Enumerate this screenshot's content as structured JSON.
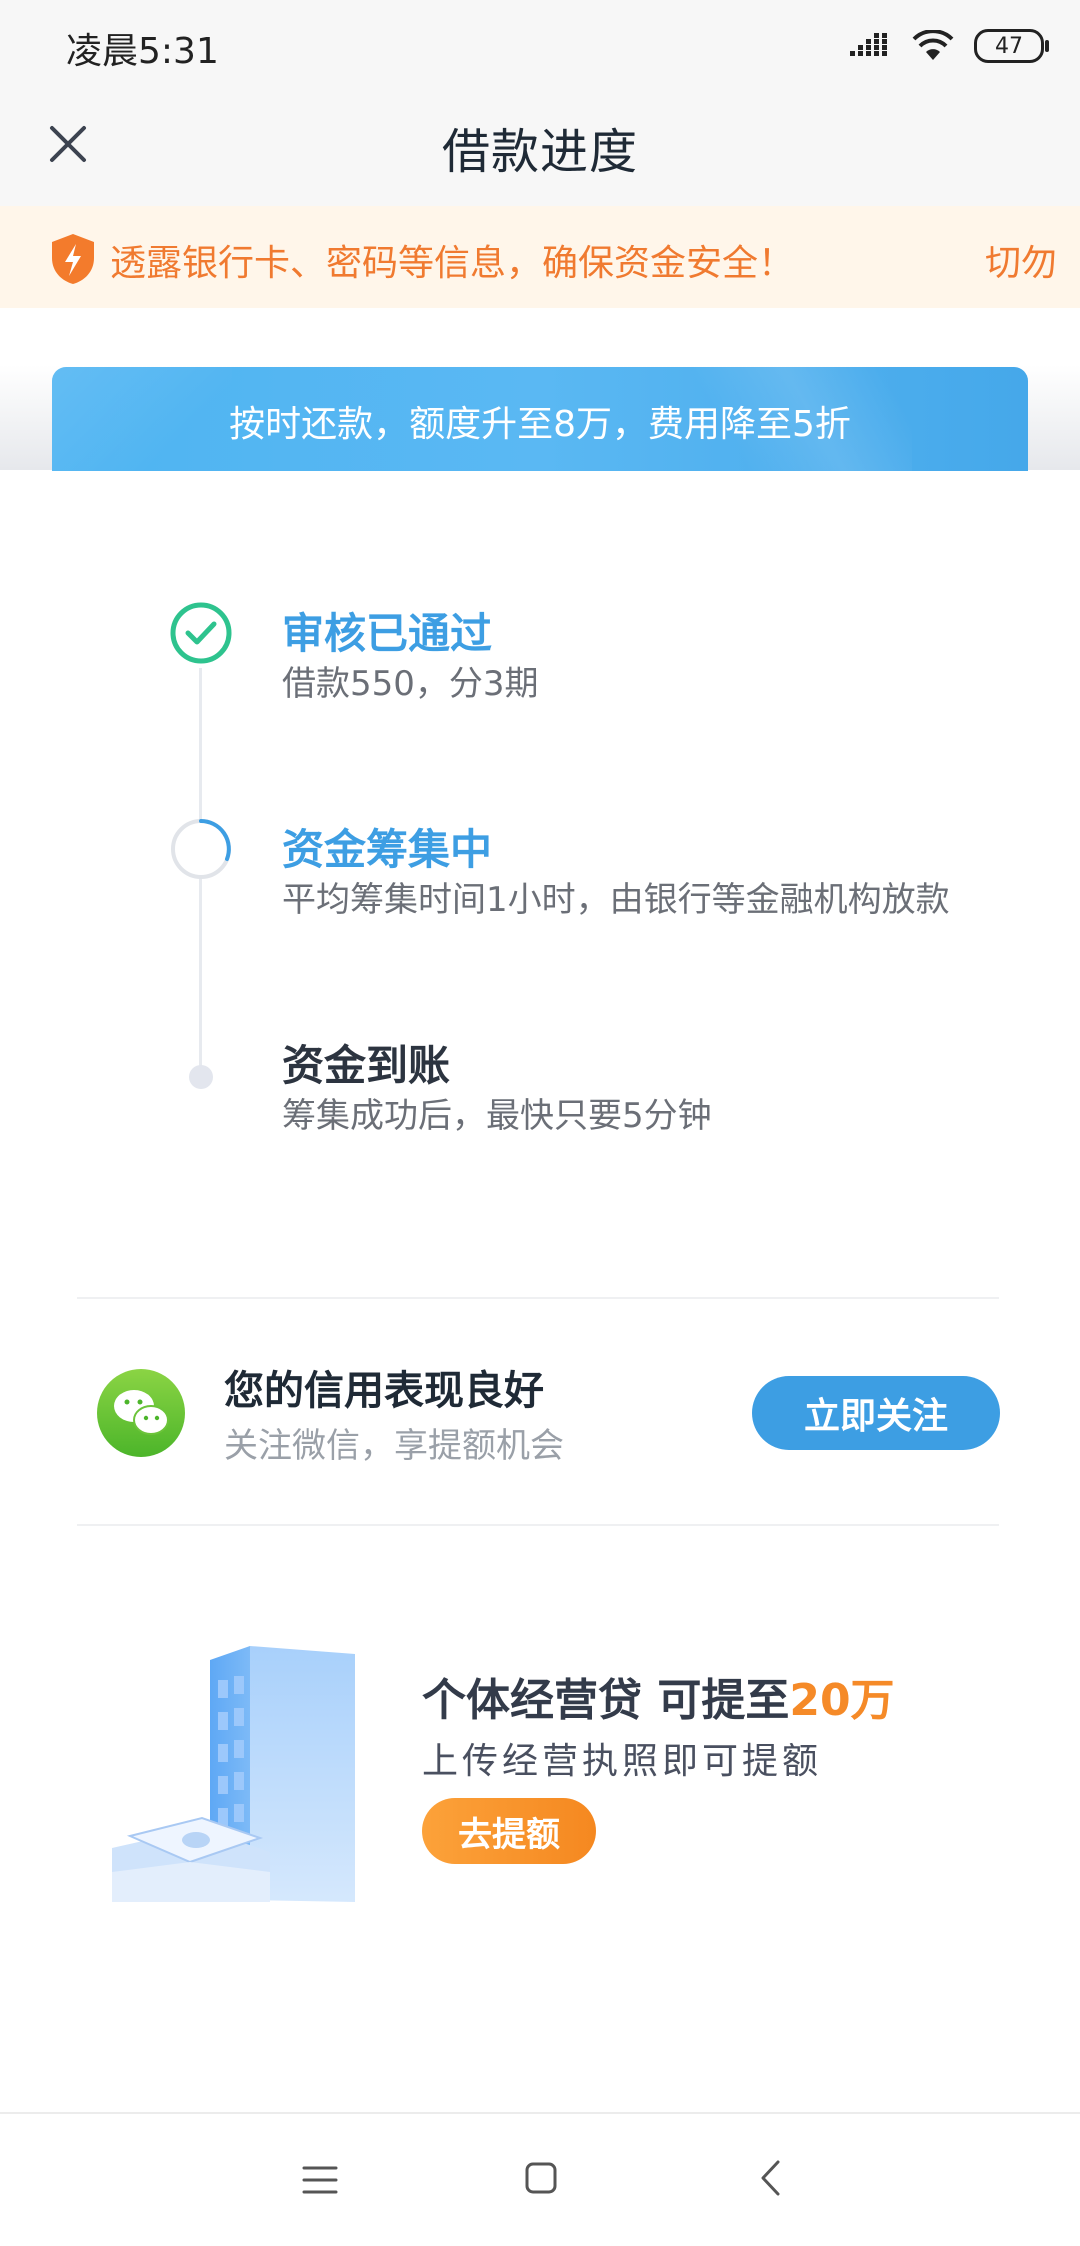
{
  "status_bar": {
    "time": "凌晨5:31",
    "battery": "47"
  },
  "nav": {
    "title": "借款进度"
  },
  "notice": {
    "text": "透露银行卡、密码等信息，确保资金安全！",
    "text_next": "切勿"
  },
  "promo": {
    "text": "按时还款，额度升至8万，费用降至5折"
  },
  "steps": [
    {
      "title": "审核已通过",
      "desc": "借款550，分3期",
      "status": "done"
    },
    {
      "title": "资金筹集中",
      "desc": "平均筹集时间1小时，由银行等金融机构放款",
      "status": "in-progress"
    },
    {
      "title": "资金到账",
      "desc": "筹集成功后，最快只要5分钟",
      "status": "pending"
    }
  ],
  "wechat_card": {
    "title": "您的信用表现良好",
    "subtitle": "关注微信，享提额机会",
    "button": "立即关注"
  },
  "loan_card": {
    "title_prefix": "个体经营贷  可提至",
    "title_amount": "20万",
    "subtitle": "上传经营执照即可提额",
    "button": "去提额"
  },
  "colors": {
    "accent_blue": "#3d9ee3",
    "success_green": "#2ec38e",
    "warning_orange": "#f07a30"
  }
}
